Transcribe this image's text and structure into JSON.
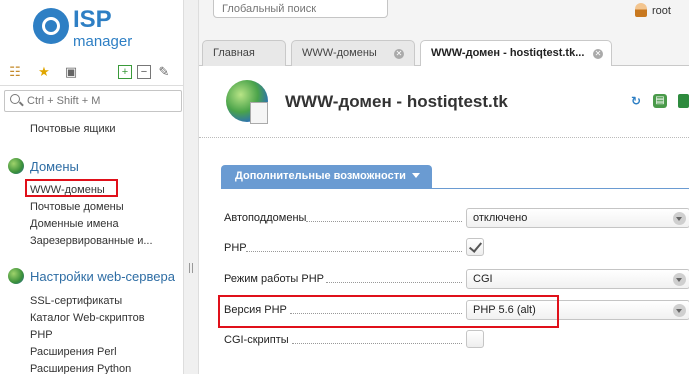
{
  "logo": {
    "brand": "ISP",
    "product": "manager"
  },
  "sidebar": {
    "search_placeholder": "Ctrl + Shift + M",
    "items_top": [
      {
        "label": "Почтовые ящики"
      }
    ],
    "groups": [
      {
        "label": "Домены",
        "icon": "globe-icon",
        "items": [
          {
            "label": "WWW-домены",
            "selected": true
          },
          {
            "label": "Почтовые домены"
          },
          {
            "label": "Доменные имена"
          },
          {
            "label": "Зарезервированные и..."
          }
        ]
      },
      {
        "label": "Настройки web-сервера",
        "icon": "globe-icon",
        "items": [
          {
            "label": "SSL-сертификаты"
          },
          {
            "label": "Каталог Web-скриптов"
          },
          {
            "label": "PHP"
          },
          {
            "label": "Расширения Perl"
          },
          {
            "label": "Расширения Python"
          }
        ]
      }
    ]
  },
  "topbar": {
    "global_search_placeholder": "Глобальный поиск",
    "user": "root"
  },
  "tabs": [
    {
      "label": "Главная",
      "closable": false,
      "active": false
    },
    {
      "label": "WWW-домены",
      "closable": true,
      "active": false
    },
    {
      "label": "WWW-домен - hostiqtest.tk...",
      "closable": true,
      "active": true
    }
  ],
  "page": {
    "title": "WWW-домен - hostiqtest.tk",
    "section_label": "Дополнительные возможности"
  },
  "form": {
    "autosubdomains": {
      "label": "Автоподдомены",
      "value": "отключено"
    },
    "php": {
      "label": "PHP",
      "checked": true
    },
    "php_mode": {
      "label": "Режим работы PHP",
      "value": "CGI"
    },
    "php_version": {
      "label": "Версия PHP",
      "value": "PHP 5.6 (alt)"
    },
    "cgi": {
      "label": "CGI-скрипты",
      "checked": false
    }
  },
  "colors": {
    "accent": "#2e7fc4",
    "section": "#6a9bd2",
    "highlight": "#e0101a"
  }
}
